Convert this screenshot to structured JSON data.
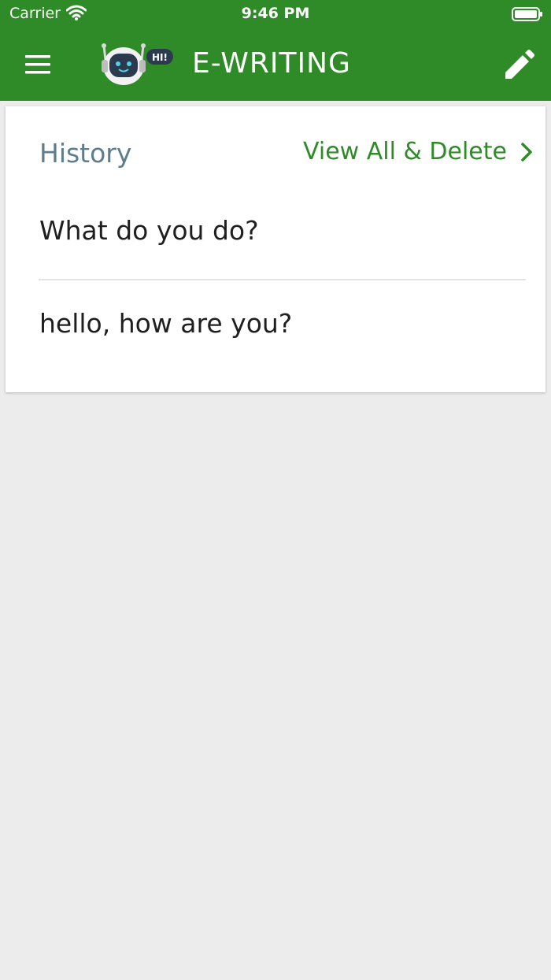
{
  "status_bar": {
    "carrier": "Carrier",
    "time": "9:46 PM"
  },
  "app_bar": {
    "title": "E-WRITING",
    "logo_badge": "HI!",
    "background_color": "#2e8b27",
    "menu_icon": "hamburger-menu-icon",
    "edit_icon": "pencil-icon"
  },
  "history": {
    "title": "History",
    "view_all_label": "View All & Delete",
    "items": [
      {
        "text": "What do you do?"
      },
      {
        "text": "hello, how are you?"
      }
    ]
  }
}
